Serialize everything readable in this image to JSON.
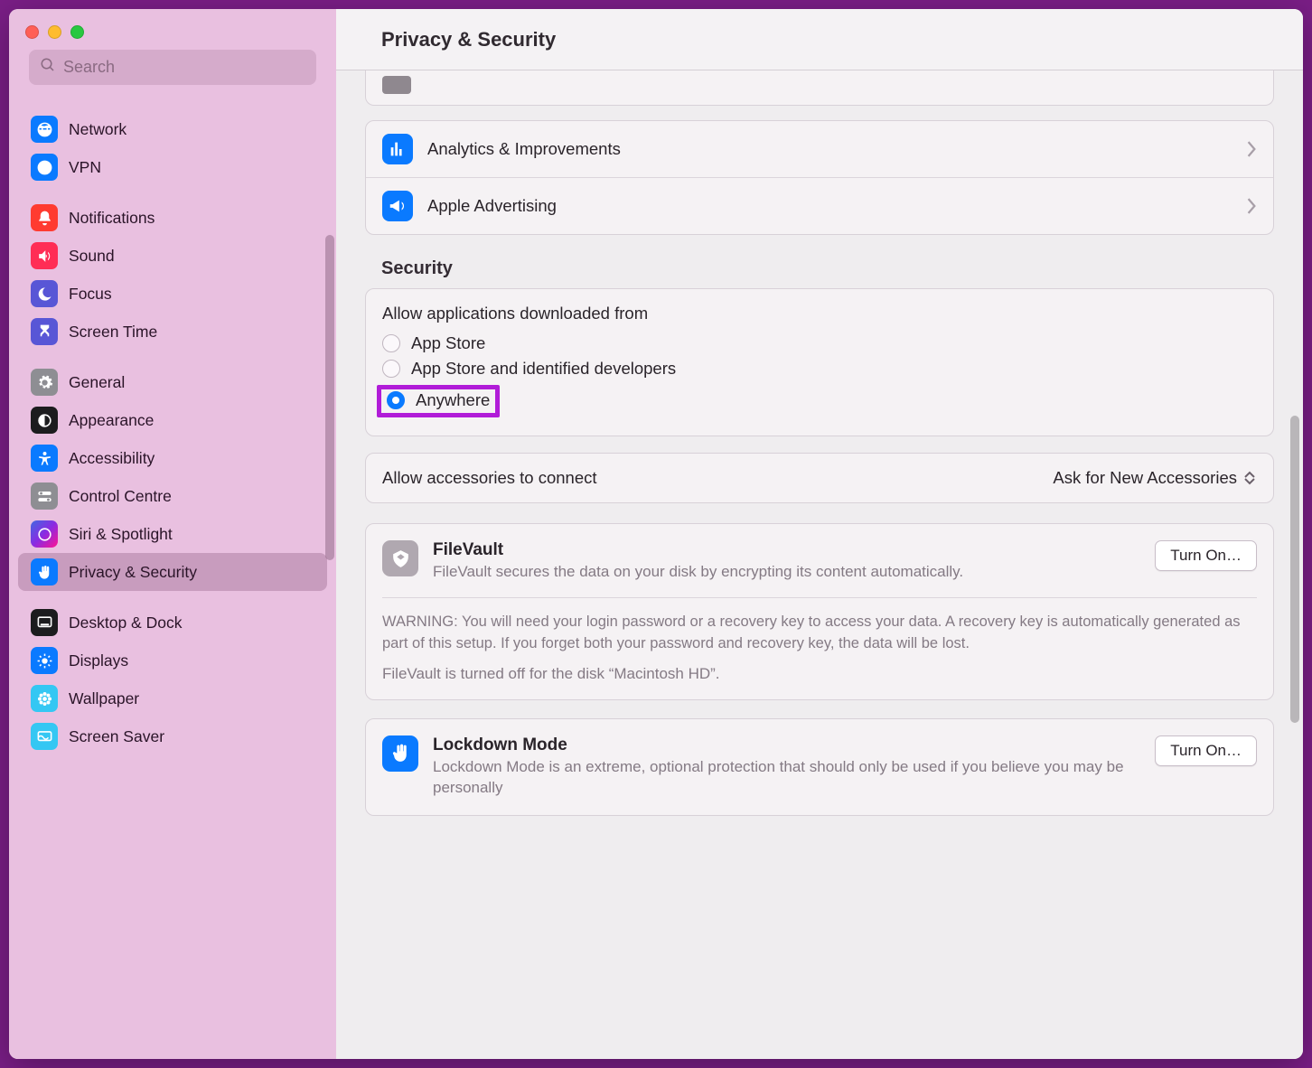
{
  "search": {
    "placeholder": "Search"
  },
  "sidebar": {
    "groups": [
      {
        "items": [
          {
            "id": "network",
            "label": "Network"
          },
          {
            "id": "vpn",
            "label": "VPN"
          }
        ]
      },
      {
        "items": [
          {
            "id": "notifications",
            "label": "Notifications"
          },
          {
            "id": "sound",
            "label": "Sound"
          },
          {
            "id": "focus",
            "label": "Focus"
          },
          {
            "id": "screen-time",
            "label": "Screen Time"
          }
        ]
      },
      {
        "items": [
          {
            "id": "general",
            "label": "General"
          },
          {
            "id": "appearance",
            "label": "Appearance"
          },
          {
            "id": "accessibility",
            "label": "Accessibility"
          },
          {
            "id": "control-centre",
            "label": "Control Centre"
          },
          {
            "id": "siri-spotlight",
            "label": "Siri & Spotlight"
          },
          {
            "id": "privacy-security",
            "label": "Privacy & Security",
            "active": true
          }
        ]
      },
      {
        "items": [
          {
            "id": "desktop-dock",
            "label": "Desktop & Dock"
          },
          {
            "id": "displays",
            "label": "Displays"
          },
          {
            "id": "wallpaper",
            "label": "Wallpaper"
          },
          {
            "id": "screen-saver",
            "label": "Screen Saver"
          }
        ]
      }
    ]
  },
  "header": {
    "title": "Privacy & Security"
  },
  "list_top": {
    "analytics": "Analytics & Improvements",
    "advertising": "Apple Advertising"
  },
  "security": {
    "title": "Security",
    "allow_from_label": "Allow applications downloaded from",
    "options": {
      "app_store": "App Store",
      "identified": "App Store and identified developers",
      "anywhere": "Anywhere"
    },
    "selected": "anywhere"
  },
  "accessories": {
    "label": "Allow accessories to connect",
    "value": "Ask for New Accessories"
  },
  "filevault": {
    "title": "FileVault",
    "desc": "FileVault secures the data on your disk by encrypting its content automatically.",
    "button": "Turn On…",
    "warning": "WARNING: You will need your login password or a recovery key to access your data. A recovery key is automatically generated as part of this setup. If you forget both your password and recovery key, the data will be lost.",
    "status": "FileVault is turned off for the disk “Macintosh HD”."
  },
  "lockdown": {
    "title": "Lockdown Mode",
    "desc": "Lockdown Mode is an extreme, optional protection that should only be used if you believe you may be personally",
    "button": "Turn On…"
  },
  "colors": {
    "accent": "#0a7aff",
    "highlight": "#b11cd8",
    "sidebar_bg": "#e9c0e0"
  }
}
